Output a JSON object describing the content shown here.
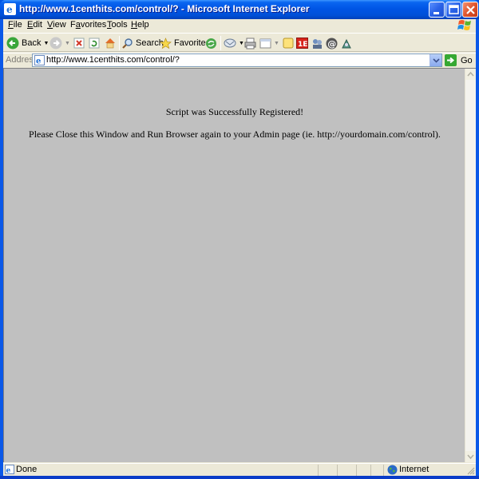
{
  "window": {
    "title": "http://www.1centhits.com/control/? - Microsoft Internet Explorer"
  },
  "menu": {
    "items": [
      {
        "accel": "F",
        "rest": "ile"
      },
      {
        "accel": "E",
        "rest": "dit"
      },
      {
        "accel": "V",
        "rest": "iew"
      },
      {
        "pre": "F",
        "accel": "a",
        "rest": "vorites"
      },
      {
        "accel": "T",
        "rest": "ools"
      },
      {
        "accel": "H",
        "rest": "elp"
      }
    ]
  },
  "toolbar": {
    "back_label": "Back",
    "search_label": "Search",
    "favorites_label": "Favorites"
  },
  "address": {
    "label": "Address",
    "url": "http://www.1centhits.com/control/?",
    "go_label": "Go"
  },
  "content": {
    "line1": "Script was Successfully Registered!",
    "line2": "Please Close this Window and Run Browser again to your Admin page (ie. http://yourdomain.com/control)."
  },
  "status": {
    "text": "Done",
    "zone": "Internet"
  },
  "colors": {
    "titlebar": "#0055e5",
    "page_background": "#c0c0c0",
    "chrome": "#ece9d8"
  }
}
